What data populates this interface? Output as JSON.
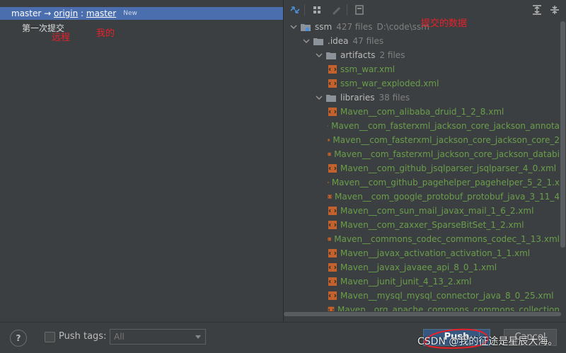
{
  "left_panel": {
    "branch": {
      "local": "master",
      "arrow": "→",
      "remote": "origin",
      "separator": ":",
      "remote_branch": "master",
      "badge": "New"
    },
    "commit_message": "第一次提交",
    "annotations": {
      "remote": "远程",
      "mine": "我的"
    }
  },
  "right_panel": {
    "annotation": "提交的数据",
    "toolbar_icons": [
      "expand-diff-icon",
      "group-by-icon",
      "edit-icon",
      "show-diff-icon",
      "expand-all-icon",
      "collapse-all-icon"
    ],
    "tree": [
      {
        "depth": 0,
        "type": "dir",
        "name": "ssm",
        "count": "427 files",
        "path": "D:\\code\\ssm",
        "expanded": true
      },
      {
        "depth": 1,
        "type": "dir",
        "name": ".idea",
        "count": "47 files",
        "expanded": true
      },
      {
        "depth": 2,
        "type": "dir",
        "name": "artifacts",
        "count": "2 files",
        "expanded": true
      },
      {
        "depth": 3,
        "type": "file",
        "name": "ssm_war.xml"
      },
      {
        "depth": 3,
        "type": "file",
        "name": "ssm_war_exploded.xml"
      },
      {
        "depth": 2,
        "type": "dir",
        "name": "libraries",
        "count": "38 files",
        "expanded": true
      },
      {
        "depth": 3,
        "type": "file",
        "name": "Maven__com_alibaba_druid_1_2_8.xml"
      },
      {
        "depth": 3,
        "type": "file",
        "name": "Maven__com_fasterxml_jackson_core_jackson_annota"
      },
      {
        "depth": 3,
        "type": "file",
        "name": "Maven__com_fasterxml_jackson_core_jackson_core_2"
      },
      {
        "depth": 3,
        "type": "file",
        "name": "Maven__com_fasterxml_jackson_core_jackson_databi"
      },
      {
        "depth": 3,
        "type": "file",
        "name": "Maven__com_github_jsqlparser_jsqlparser_4_0.xml"
      },
      {
        "depth": 3,
        "type": "file",
        "name": "Maven__com_github_pagehelper_pagehelper_5_2_1.x"
      },
      {
        "depth": 3,
        "type": "file",
        "name": "Maven__com_google_protobuf_protobuf_java_3_11_4"
      },
      {
        "depth": 3,
        "type": "file",
        "name": "Maven__com_sun_mail_javax_mail_1_6_2.xml"
      },
      {
        "depth": 3,
        "type": "file",
        "name": "Maven__com_zaxxer_SparseBitSet_1_2.xml"
      },
      {
        "depth": 3,
        "type": "file",
        "name": "Maven__commons_codec_commons_codec_1_13.xml"
      },
      {
        "depth": 3,
        "type": "file",
        "name": "Maven__javax_activation_activation_1_1.xml"
      },
      {
        "depth": 3,
        "type": "file",
        "name": "Maven__javax_javaee_api_8_0_1.xml"
      },
      {
        "depth": 3,
        "type": "file",
        "name": "Maven__junit_junit_4_13_2.xml"
      },
      {
        "depth": 3,
        "type": "file",
        "name": "Maven__mysql_mysql_connector_java_8_0_25.xml"
      },
      {
        "depth": 3,
        "type": "file",
        "name": "Maven__org_apache_commons_commons_collection"
      }
    ]
  },
  "bottom_bar": {
    "help": "?",
    "push_tags_label": "Push tags:",
    "push_tags_value": "All",
    "push_button": "Push",
    "cancel_button": "Cancel",
    "watermark": "CSDN @我的征途是星辰大海。"
  },
  "colors": {
    "background": "#3c3f41",
    "selection": "#4b6eaf",
    "annotation_red": "#e8202a",
    "file_green": "#6a9e4a",
    "xml_icon_orange": "#c4622d"
  }
}
